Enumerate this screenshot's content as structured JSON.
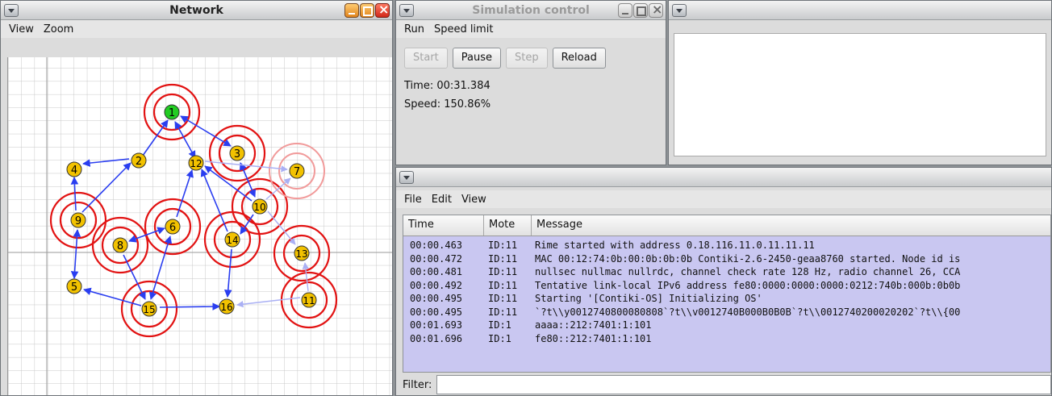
{
  "network": {
    "title": "Network",
    "menu": [
      "View",
      "Zoom"
    ],
    "nodes": [
      {
        "id": "1",
        "state": "root"
      },
      {
        "id": "2"
      },
      {
        "id": "3"
      },
      {
        "id": "4"
      },
      {
        "id": "5"
      },
      {
        "id": "6"
      },
      {
        "id": "7",
        "state": "faded"
      },
      {
        "id": "8"
      },
      {
        "id": "9"
      },
      {
        "id": "10"
      },
      {
        "id": "11"
      },
      {
        "id": "12"
      },
      {
        "id": "13"
      },
      {
        "id": "14"
      },
      {
        "id": "15"
      },
      {
        "id": "16"
      }
    ],
    "colors": {
      "node": "#f2c200",
      "root": "#22cc22",
      "ring": "#e21212",
      "edge": "#2a3ef0"
    }
  },
  "simulation": {
    "title": "Simulation control",
    "menu": [
      "Run",
      "Speed limit"
    ],
    "buttons": {
      "start": "Start",
      "pause": "Pause",
      "step": "Step",
      "reload": "Reload"
    },
    "time_label": "Time: 00:31.384",
    "speed_label": "Speed: 150.86%"
  },
  "log": {
    "menu": [
      "File",
      "Edit",
      "View"
    ],
    "columns": [
      "Time",
      "Mote",
      "Message"
    ],
    "rows": [
      {
        "time": "00:00.463",
        "mote": "ID:11",
        "message": "Rime started with address 0.18.116.11.0.11.11.11"
      },
      {
        "time": "00:00.472",
        "mote": "ID:11",
        "message": "MAC 00:12:74:0b:00:0b:0b:0b Contiki-2.6-2450-geaa8760 started. Node id is"
      },
      {
        "time": "00:00.481",
        "mote": "ID:11",
        "message": "nullsec nullmac nullrdc, channel check rate 128 Hz, radio channel 26, CCA"
      },
      {
        "time": "00:00.492",
        "mote": "ID:11",
        "message": "Tentative link-local IPv6 address fe80:0000:0000:0000:0212:740b:000b:0b0b"
      },
      {
        "time": "00:00.495",
        "mote": "ID:11",
        "message": "Starting '[Contiki-OS] Initializing OS'"
      },
      {
        "time": "00:00.495",
        "mote": "ID:11",
        "message": " `?t\\\\y0012740800080808`?t\\\\v0012740B000B0B0B`?t\\\\0012740200020202`?t\\\\{00"
      },
      {
        "time": "00:01.693",
        "mote": "ID:1",
        "message": " aaaa::212:7401:1:101"
      },
      {
        "time": "00:01.696",
        "mote": "ID:1",
        "message": " fe80::212:7401:1:101"
      }
    ],
    "filter_label": "Filter:",
    "filter_value": ""
  }
}
